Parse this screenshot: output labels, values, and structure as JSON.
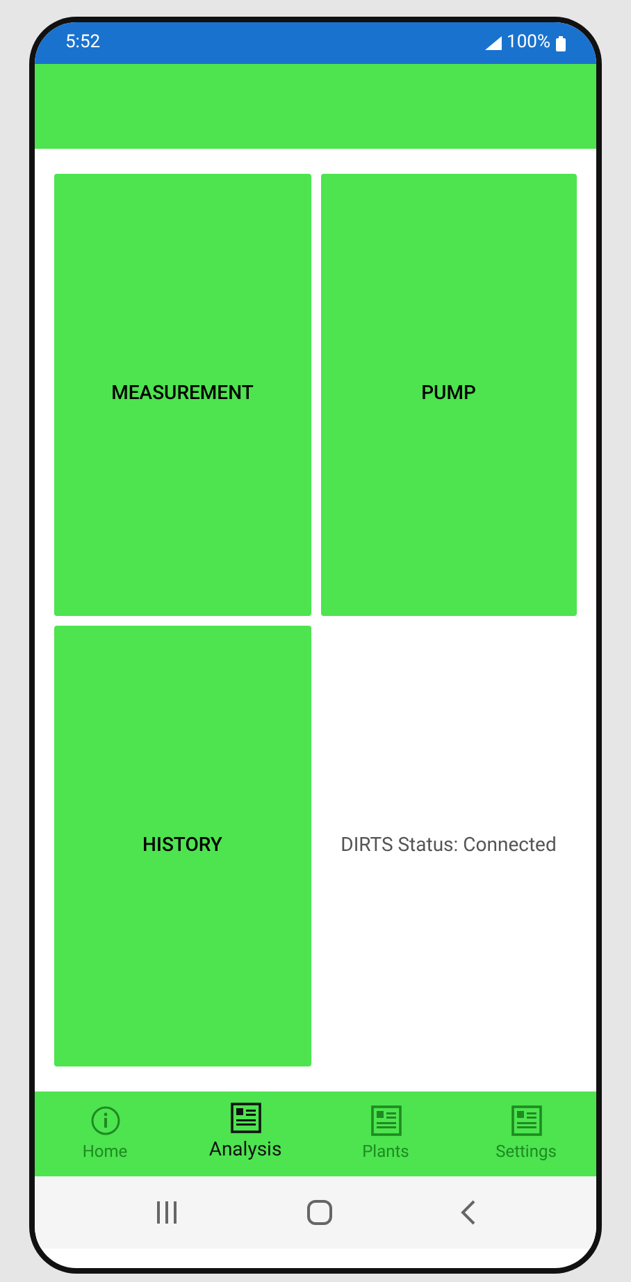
{
  "status_bar": {
    "time": "5:52",
    "battery": "100%"
  },
  "tiles": [
    {
      "label": "MEASUREMENT"
    },
    {
      "label": "PUMP"
    },
    {
      "label": "HISTORY"
    }
  ],
  "connection_status": "DIRTS Status: Connected",
  "bottom_nav": [
    {
      "label": "Home",
      "kind": "info",
      "selected": false
    },
    {
      "label": "Analysis",
      "kind": "sheet",
      "selected": true
    },
    {
      "label": "Plants",
      "kind": "sheet",
      "selected": false
    },
    {
      "label": "Settings",
      "kind": "sheet",
      "selected": false
    }
  ]
}
